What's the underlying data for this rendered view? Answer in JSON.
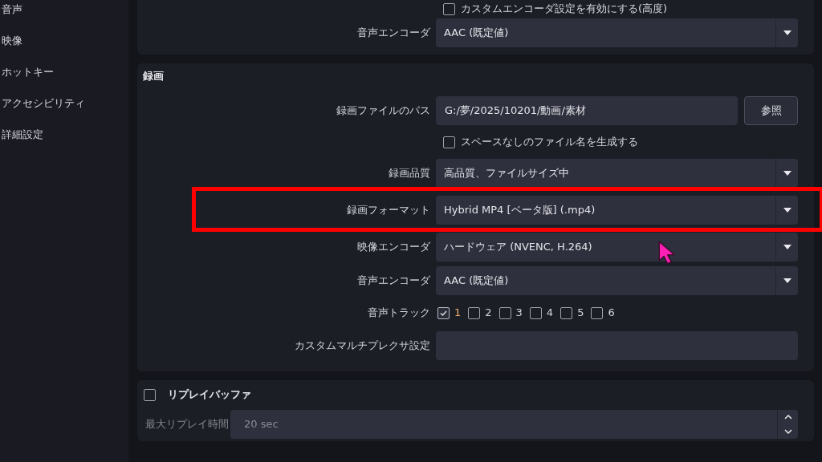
{
  "sidebar": {
    "items": [
      {
        "label": "音声"
      },
      {
        "label": "映像"
      },
      {
        "label": "ホットキー"
      },
      {
        "label": "アクセシビリティ"
      },
      {
        "label": "詳細設定"
      }
    ]
  },
  "streaming": {
    "checkbox": {
      "label": "カスタムエンコーダ設定を有効にする(高度)",
      "checked": false
    },
    "rows": [
      {
        "kind": "dropdown",
        "label": "音声エンコーダ",
        "value": "AAC (既定値)",
        "highlighted": false
      }
    ]
  },
  "recording": {
    "title": "録画",
    "rows": [
      {
        "kind": "path",
        "label": "録画ファイルのパス",
        "value": "G:/夢/2025/10201/動画/素材",
        "button": "参照"
      },
      {
        "kind": "checkbox",
        "label": "スペースなしのファイル名を生成する",
        "checked": false
      },
      {
        "kind": "dropdown",
        "label": "録画品質",
        "value": "高品質、ファイルサイズ中",
        "highlighted": false
      },
      {
        "kind": "dropdown",
        "label": "録画フォーマット",
        "value": "Hybrid MP4 [ベータ版] (.mp4)",
        "highlighted": true
      },
      {
        "kind": "dropdown",
        "label": "映像エンコーダ",
        "value": "ハードウェア (NVENC, H.264)",
        "highlighted": false
      },
      {
        "kind": "dropdown",
        "label": "音声エンコーダ",
        "value": "AAC (既定値)",
        "highlighted": false
      },
      {
        "kind": "tracks",
        "label": "音声トラック",
        "tracks": [
          {
            "label": "1",
            "checked": true
          },
          {
            "label": "2",
            "checked": false
          },
          {
            "label": "3",
            "checked": false
          },
          {
            "label": "4",
            "checked": false
          },
          {
            "label": "5",
            "checked": false
          },
          {
            "label": "6",
            "checked": false
          }
        ]
      },
      {
        "kind": "text",
        "label": "カスタムマルチプレクサ設定"
      }
    ]
  },
  "replay_buffer": {
    "label": "リプレイバッファ",
    "checked": false,
    "max_time": {
      "label": "最大リプレイ時間",
      "value": "20 sec",
      "disabled": true
    }
  }
}
